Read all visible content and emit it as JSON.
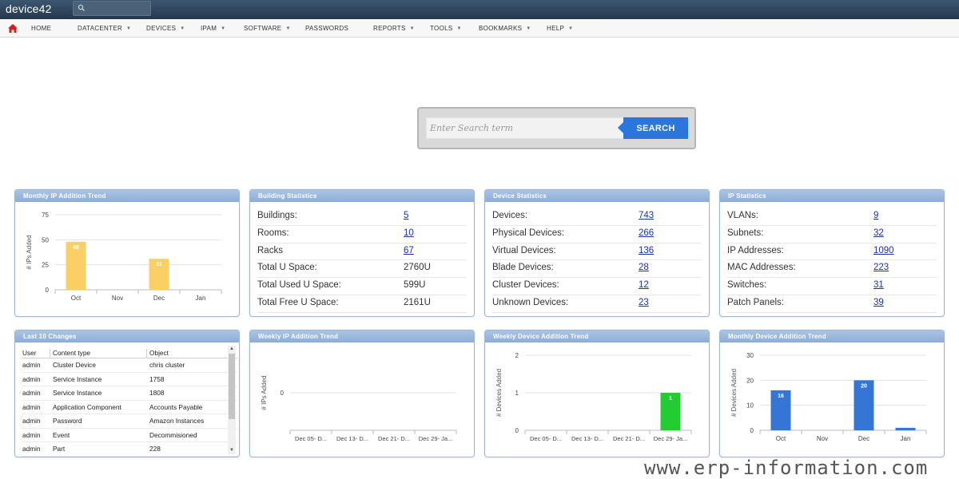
{
  "app": {
    "title": "device42"
  },
  "nav": {
    "items": [
      {
        "label": "HOME",
        "caret": false
      },
      {
        "label": "DATACENTER",
        "caret": true
      },
      {
        "label": "DEVICES",
        "caret": true
      },
      {
        "label": "IPAM",
        "caret": true
      },
      {
        "label": "SOFTWARE",
        "caret": true
      },
      {
        "label": "PASSWORDS",
        "caret": false
      },
      {
        "label": "REPORTS",
        "caret": true
      },
      {
        "label": "TOOLS",
        "caret": true
      },
      {
        "label": "BOOKMARKS",
        "caret": true
      },
      {
        "label": "HELP",
        "caret": true
      }
    ]
  },
  "search": {
    "placeholder": "Enter Search term",
    "button_label": "SEARCH"
  },
  "building_stats": {
    "title": "Building Statistics",
    "rows": [
      {
        "label": "Buildings:",
        "value": "5",
        "link": true
      },
      {
        "label": "Rooms:",
        "value": "10",
        "link": true
      },
      {
        "label": "Racks",
        "value": "67",
        "link": true
      },
      {
        "label": "Total U Space:",
        "value": "2760U",
        "link": false
      },
      {
        "label": "Total Used U Space:",
        "value": "599U",
        "link": false
      },
      {
        "label": "Total Free U Space:",
        "value": "2161U",
        "link": false
      }
    ]
  },
  "device_stats": {
    "title": "Device Statistics",
    "rows": [
      {
        "label": "Devices:",
        "value": "743",
        "link": true
      },
      {
        "label": "Physical Devices:",
        "value": "266",
        "link": true
      },
      {
        "label": "Virtual Devices:",
        "value": "136",
        "link": true
      },
      {
        "label": "Blade Devices:",
        "value": "28",
        "link": true
      },
      {
        "label": "Cluster Devices:",
        "value": "12",
        "link": true
      },
      {
        "label": "Unknown Devices:",
        "value": "23",
        "link": true
      }
    ]
  },
  "ip_stats": {
    "title": "IP Statistics",
    "rows": [
      {
        "label": "VLANs:",
        "value": "9",
        "link": true
      },
      {
        "label": "Subnets:",
        "value": "32",
        "link": true
      },
      {
        "label": "IP Addresses:",
        "value": "1090",
        "link": true
      },
      {
        "label": "MAC Addresses:",
        "value": "223",
        "link": true
      },
      {
        "label": "Switches:",
        "value": "31",
        "link": true
      },
      {
        "label": "Patch Panels:",
        "value": "39",
        "link": true
      }
    ]
  },
  "changes": {
    "title": "Last 10 Changes",
    "headers": [
      "User",
      "Content type",
      "Object"
    ],
    "rows": [
      [
        "admin",
        "Cluster Device",
        "chris cluster"
      ],
      [
        "admin",
        "Service Instance",
        "1758"
      ],
      [
        "admin",
        "Service Instance",
        "1808"
      ],
      [
        "admin",
        "Application Component",
        "Accounts Payable"
      ],
      [
        "admin",
        "Password",
        "Amazon Instances"
      ],
      [
        "admin",
        "Event",
        "Decommisioned"
      ],
      [
        "admin",
        "Part",
        "228"
      ]
    ]
  },
  "chart_data": [
    {
      "id": "monthly_ip",
      "title": "Monthly IP Addition Trend",
      "type": "bar",
      "categories": [
        "Oct",
        "Nov",
        "Dec",
        "Jan"
      ],
      "values": [
        48,
        0,
        31,
        0
      ],
      "ylabel": "# IPs Added",
      "yticks": [
        0,
        25,
        50,
        75
      ],
      "ylim": [
        0,
        75
      ],
      "color": "#f9cf66",
      "show_labels": [
        true,
        false,
        true,
        false
      ]
    },
    {
      "id": "weekly_ip",
      "title": "Weekly IP Addition Trend",
      "type": "bar",
      "categories": [
        "Dec 05- D...",
        "Dec 13- D...",
        "Dec 21- D...",
        "Dec 29- Ja..."
      ],
      "values": [
        0,
        0,
        0,
        0
      ],
      "ylabel": "# IPs Added",
      "yticks": [
        0
      ],
      "ylim": [
        -1,
        1
      ],
      "color": "#4a90e2",
      "show_labels": [
        false,
        false,
        false,
        false
      ]
    },
    {
      "id": "weekly_device",
      "title": "Weekly Device Addition Trend",
      "type": "bar",
      "categories": [
        "Dec 05- D...",
        "Dec 13- D...",
        "Dec 21- D...",
        "Dec 29- Ja..."
      ],
      "values": [
        0,
        0,
        0,
        1
      ],
      "ylabel": "# Devices Added",
      "yticks": [
        0,
        1,
        2
      ],
      "ylim": [
        0,
        2
      ],
      "color": "#22cc33",
      "show_labels": [
        false,
        false,
        false,
        true
      ]
    },
    {
      "id": "monthly_device",
      "title": "Monthly Device Addition Trend",
      "type": "bar",
      "categories": [
        "Oct",
        "Nov",
        "Dec",
        "Jan"
      ],
      "values": [
        16,
        0,
        20,
        1
      ],
      "ylabel": "# Devices Added",
      "yticks": [
        0,
        10,
        20,
        30
      ],
      "ylim": [
        0,
        30
      ],
      "color": "#3575d6",
      "show_labels": [
        true,
        false,
        true,
        false
      ]
    }
  ],
  "watermark": "www.erp-information.com"
}
